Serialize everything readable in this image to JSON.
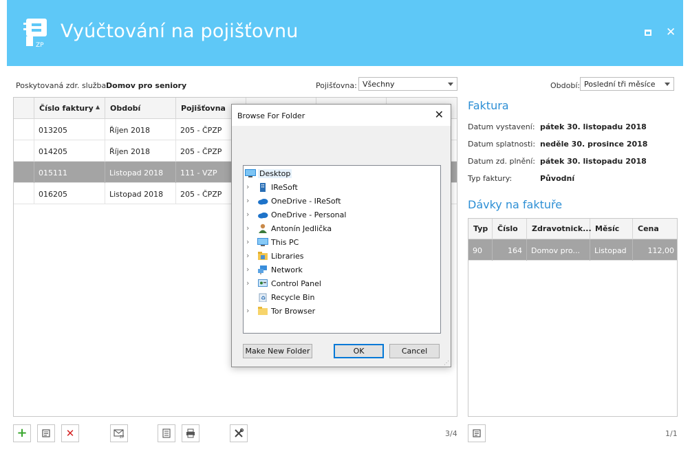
{
  "app": {
    "title": "Vyúčtování na pojišťovnu",
    "logo_text": "ZP"
  },
  "filters": {
    "service_label": "Poskytovaná zdr. služba:",
    "service_value": "Domov pro seniory",
    "insurer_label": "Pojišťovna:",
    "insurer_value": "Všechny",
    "period_label": "Období:",
    "period_value": "Poslední tři měsíce"
  },
  "invoices": {
    "columns": [
      "Číslo faktury",
      "Období",
      "Pojišťovna"
    ],
    "rows": [
      {
        "number": "013205",
        "period": "Říjen 2018",
        "insurer": "205 - ČPZP"
      },
      {
        "number": "014205",
        "period": "Říjen 2018",
        "insurer": "205 - ČPZP"
      },
      {
        "number": "015111",
        "period": "Listopad 2018",
        "insurer": "111 - VZP"
      },
      {
        "number": "016205",
        "period": "Listopad 2018",
        "insurer": "205 - ČPZP"
      }
    ],
    "pager": "3/4"
  },
  "invoice_detail": {
    "title": "Faktura",
    "fields": [
      {
        "label": "Datum vystavení:",
        "value": "pátek 30. listopadu 2018"
      },
      {
        "label": "Datum splatnosti:",
        "value": "neděle 30. prosince 2018"
      },
      {
        "label": "Datum zd. plnění:",
        "value": "pátek 30. listopadu 2018"
      },
      {
        "label": "Typ faktury:",
        "value": "Původní"
      }
    ]
  },
  "batches": {
    "title": "Dávky na faktuře",
    "columns": [
      "Typ",
      "Číslo",
      "Zdravotnick...",
      "Měsíc",
      "Cena"
    ],
    "rows": [
      {
        "type": "90",
        "number": "164",
        "facility": "Domov pro...",
        "month": "Listopad",
        "price": "112,00"
      }
    ],
    "pager": "1/1"
  },
  "toolbar": {
    "icons": [
      "add-icon",
      "edit-icon",
      "delete-icon",
      "envelope-zp-icon",
      "document-icon",
      "print-icon",
      "tools-icon"
    ]
  },
  "dialog": {
    "title": "Browse For Folder",
    "tree": [
      {
        "label": "Desktop",
        "icon": "desktop-icon",
        "root": true
      },
      {
        "label": "IReSoft",
        "icon": "building-icon"
      },
      {
        "label": "OneDrive - IReSoft",
        "icon": "cloud-icon"
      },
      {
        "label": "OneDrive - Personal",
        "icon": "cloud-icon"
      },
      {
        "label": "Antonín Jedlička",
        "icon": "user-icon"
      },
      {
        "label": "This PC",
        "icon": "computer-icon"
      },
      {
        "label": "Libraries",
        "icon": "libraries-icon"
      },
      {
        "label": "Network",
        "icon": "network-icon"
      },
      {
        "label": "Control Panel",
        "icon": "control-panel-icon"
      },
      {
        "label": "Recycle Bin",
        "icon": "recycle-bin-icon"
      },
      {
        "label": "Tor Browser",
        "icon": "folder-icon"
      }
    ],
    "buttons": {
      "new_folder": "Make New Folder",
      "ok": "OK",
      "cancel": "Cancel"
    }
  },
  "colors": {
    "titlebar": "#5ec8f7",
    "accent": "#2d8fd5",
    "selection": "#a4a4a4"
  }
}
